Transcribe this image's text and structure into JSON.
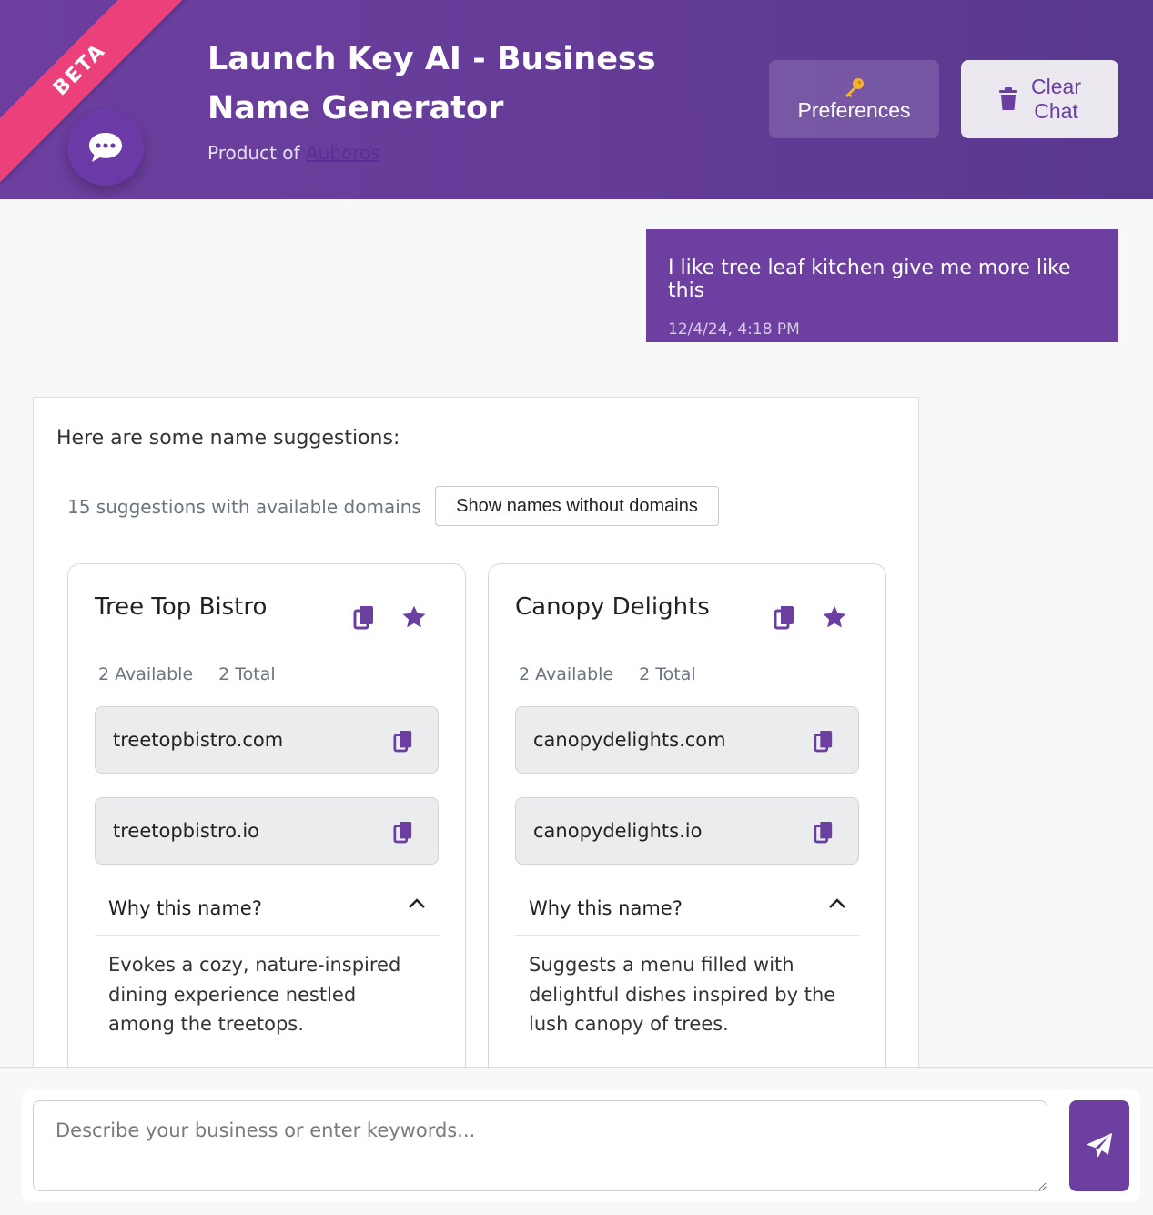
{
  "header": {
    "beta": "BETA",
    "title": "Launch Key AI - Business Name Generator",
    "product_prefix": "Product of ",
    "product_link": "Auboros",
    "preferences_label": "Preferences",
    "clear_label_1": "Clear",
    "clear_label_2": "Chat"
  },
  "user_message": {
    "text": "I like tree leaf kitchen give me more like this",
    "timestamp": "12/4/24, 4:18 PM"
  },
  "bot_message": {
    "intro": "Here are some name suggestions:",
    "count_text": "15 suggestions with available domains",
    "toggle_label": "Show names without domains",
    "cards": [
      {
        "name": "Tree Top Bistro",
        "available": "2 Available",
        "total": "2 Total",
        "domains": [
          "treetopbistro.com",
          "treetopbistro.io"
        ],
        "why_label": "Why this name?",
        "reason": "Evokes a cozy, nature-inspired dining experience nestled among the treetops."
      },
      {
        "name": "Canopy Delights",
        "available": "2 Available",
        "total": "2 Total",
        "domains": [
          "canopydelights.com",
          "canopydelights.io"
        ],
        "why_label": "Why this name?",
        "reason": "Suggests a menu filled with delightful dishes inspired by the lush canopy of trees."
      }
    ]
  },
  "composer": {
    "placeholder": "Describe your business or enter keywords..."
  },
  "colors": {
    "brand_purple": "#6c3fa0",
    "beta_pink": "#ec407a",
    "key_yellow": "#f2b233"
  },
  "icons": {
    "logo": "chat-bubble-icon",
    "preferences": "key-icon",
    "clear": "trash-icon",
    "copy": "copy-icon",
    "favorite": "star-icon",
    "collapse": "chevron-up-icon",
    "send": "paper-plane-icon"
  }
}
